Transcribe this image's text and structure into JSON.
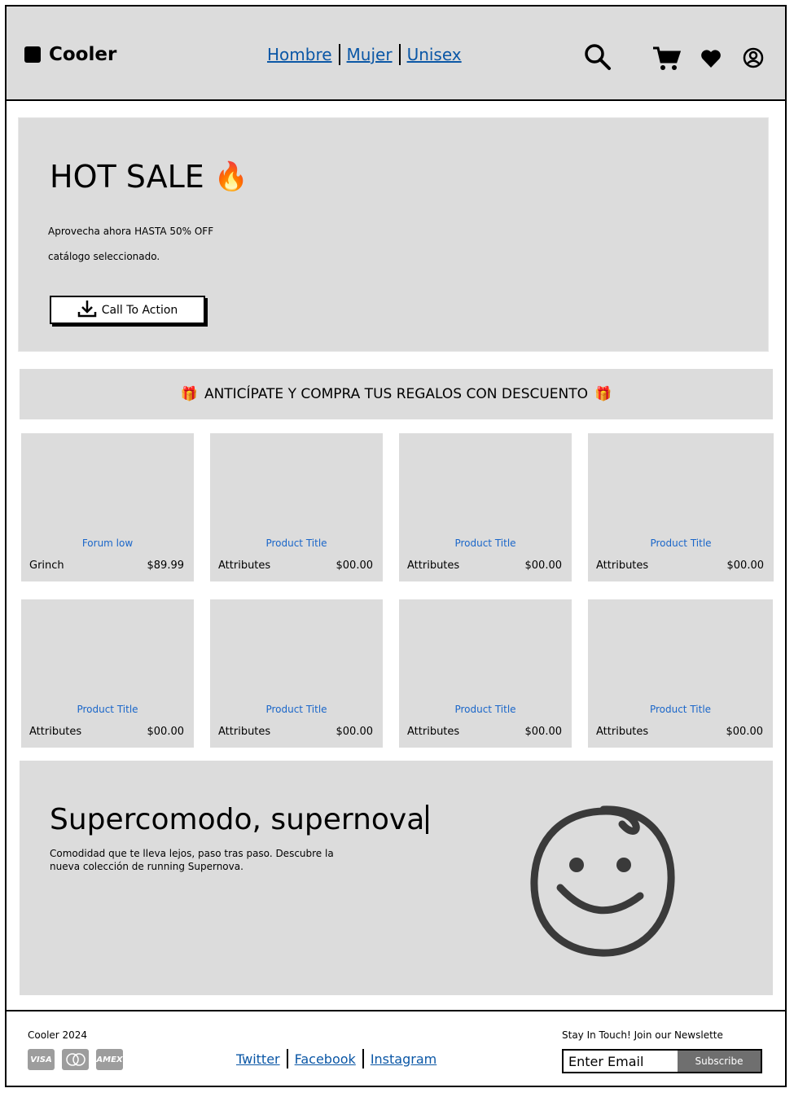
{
  "brand": {
    "name": "Cooler"
  },
  "nav": {
    "items": [
      "Hombre",
      "Mujer",
      "Unisex"
    ]
  },
  "header_icons": [
    "search-icon",
    "cart-icon",
    "heart-icon",
    "user-icon"
  ],
  "hero": {
    "title": "HOT SALE",
    "emoji": "🔥",
    "line1": "Aprovecha ahora HASTA 50% OFF",
    "line2": "catálogo seleccionado.",
    "cta_label": "Call To Action"
  },
  "promo": {
    "text": "ANTICÍPATE Y COMPRA TUS REGALOS CON DESCUENTO",
    "emoji": "🎁"
  },
  "products": [
    {
      "title": "Forum low",
      "attributes": "Grinch",
      "price": "$89.99"
    },
    {
      "title": "Product Title",
      "attributes": "Attributes",
      "price": "$00.00"
    },
    {
      "title": "Product Title",
      "attributes": "Attributes",
      "price": "$00.00"
    },
    {
      "title": "Product Title",
      "attributes": "Attributes",
      "price": "$00.00"
    },
    {
      "title": "Product Title",
      "attributes": "Attributes",
      "price": "$00.00"
    },
    {
      "title": "Product Title",
      "attributes": "Attributes",
      "price": "$00.00"
    },
    {
      "title": "Product Title",
      "attributes": "Attributes",
      "price": "$00.00"
    },
    {
      "title": "Product Title",
      "attributes": "Attributes",
      "price": "$00.00"
    }
  ],
  "feature": {
    "title": "Supercomodo, supernova",
    "description": "Comodidad que te lleva lejos, paso tras paso. Descubre la nueva colección de running Supernova."
  },
  "footer": {
    "copyright": "Cooler 2024",
    "payment_cards": [
      "VISA",
      "MC",
      "AMEX"
    ],
    "social": [
      "Twitter",
      "Facebook",
      "Instagram"
    ],
    "newsletter_label": "Stay In Touch! Join our Newslette",
    "email_placeholder": "Enter Email",
    "subscribe_label": "Subscribe"
  },
  "colors": {
    "panel": "#dcdcdc",
    "link": "#0b57a6",
    "product_title": "#1a66c9",
    "subscribe_bg": "#6f6f6f"
  }
}
